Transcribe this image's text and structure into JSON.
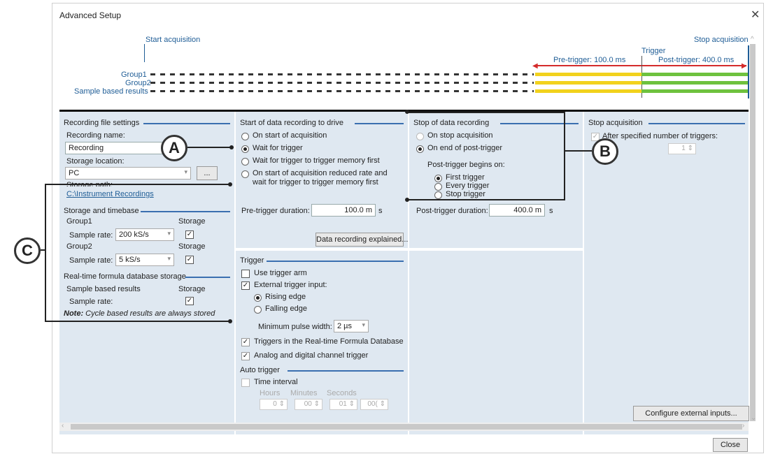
{
  "window": {
    "title": "Advanced Setup"
  },
  "timeline": {
    "start_acquisition": "Start acquisition",
    "stop_acquisition": "Stop acquisition",
    "trigger": "Trigger",
    "pre_trigger": "Pre-trigger: 100.0 ms",
    "post_trigger": "Post-trigger: 400.0 ms",
    "rows": [
      "Group1",
      "Group2",
      "Sample based results"
    ]
  },
  "recording_file": {
    "section": "Recording file settings",
    "name_label": "Recording name:",
    "name_value": "Recording",
    "location_label": "Storage location:",
    "location_value": "PC",
    "browse": "...",
    "path_label": "Storage path:",
    "path_link": "C:\\Instrument Recordings"
  },
  "storage_timebase": {
    "section": "Storage and timebase",
    "group1": "Group1",
    "group2": "Group2",
    "storage_col": "Storage",
    "sample_rate_label": "Sample rate:",
    "group1_rate": "200 kS/s",
    "group2_rate": "5 kS/s"
  },
  "realtime_db": {
    "section": "Real-time formula database storage",
    "sample_based": "Sample based results",
    "storage_col": "Storage",
    "sample_rate_label": "Sample rate:",
    "note_bold": "Note:",
    "note_text": "Cycle based results are always stored"
  },
  "start_recording": {
    "section": "Start of data recording to drive",
    "options": [
      "On start of acquisition",
      "Wait for trigger",
      "Wait for trigger to trigger memory first",
      "On start of acquisition reduced rate and",
      "wait for trigger to trigger memory first"
    ],
    "pre_trigger_label": "Pre-trigger duration:",
    "pre_trigger_value": "100.0 m",
    "unit": "s",
    "explain_button": "Data recording explained..."
  },
  "stop_recording": {
    "section": "Stop of data recording",
    "options": [
      "On stop acquisition",
      "On end of post-trigger"
    ],
    "post_begins_label": "Post-trigger begins on:",
    "post_options": [
      "First trigger",
      "Every trigger",
      "Stop trigger"
    ],
    "post_trigger_label": "Post-trigger duration:",
    "post_trigger_value": "400.0 m",
    "unit": "s"
  },
  "stop_acquisition": {
    "section": "Stop acquisition",
    "after_triggers": "After specified number of triggers:",
    "count": "1"
  },
  "trigger": {
    "section": "Trigger",
    "use_arm": "Use trigger arm",
    "external_input": "External trigger input:",
    "rising": "Rising edge",
    "falling": "Falling edge",
    "min_pulse_label": "Minimum pulse width:",
    "min_pulse_value": "2 µs",
    "rt_db": "Triggers in the Real-time Formula Database",
    "analog_digital": "Analog and digital channel trigger"
  },
  "auto_trigger": {
    "section": "Auto trigger",
    "time_interval": "Time interval",
    "hours": "Hours",
    "minutes": "Minutes",
    "seconds": "Seconds",
    "h_val": "0",
    "m_val": "00",
    "s_val": "01",
    "ms_val": "00("
  },
  "buttons": {
    "configure": "Configure external inputs...",
    "close": "Close"
  },
  "callouts": [
    "A",
    "B",
    "C"
  ],
  "colors": {
    "pre_trigger_bar": "#f2d21d",
    "post_trigger_bar": "#6ec23e",
    "trigger_arrow": "#d42b2b",
    "accent": "#3a6fb0"
  }
}
